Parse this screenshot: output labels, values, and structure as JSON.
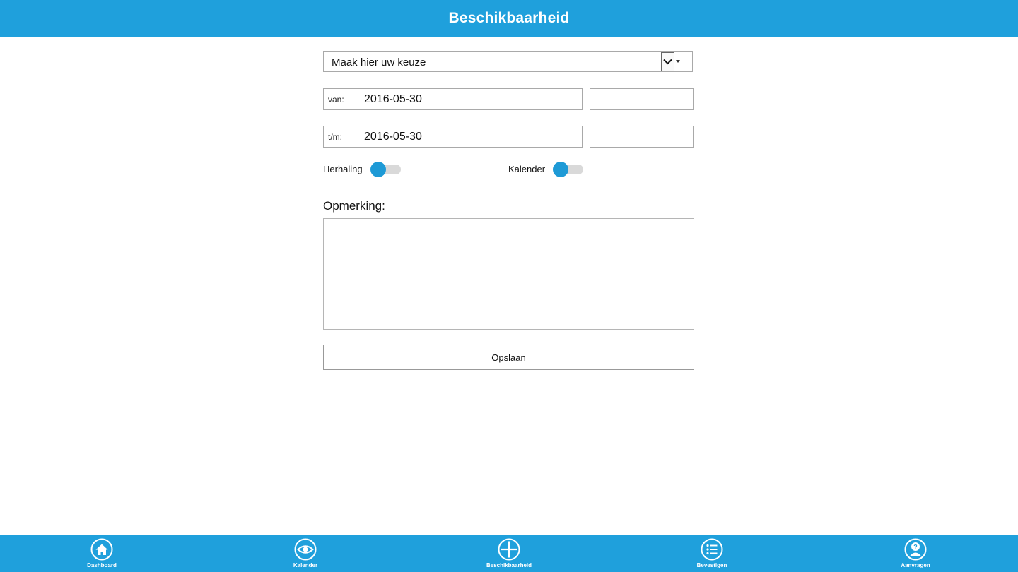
{
  "header": {
    "title": "Beschikbaarheid"
  },
  "form": {
    "select": {
      "value": "Maak hier uw keuze"
    },
    "from": {
      "label": "van:",
      "date": "2016-05-30",
      "time": ""
    },
    "to": {
      "label": "t/m:",
      "date": "2016-05-30",
      "time": ""
    },
    "toggles": [
      {
        "label": "Herhaling",
        "on": false
      },
      {
        "label": "Kalender",
        "on": false
      }
    ],
    "remark": {
      "label": "Opmerking:",
      "value": ""
    },
    "save_label": "Opslaan"
  },
  "nav": {
    "items": [
      {
        "label": "Dashboard",
        "icon": "home-icon"
      },
      {
        "label": "Kalender",
        "icon": "eye-icon"
      },
      {
        "label": "Beschikbaarheid",
        "icon": "plus-icon"
      },
      {
        "label": "Bevestigen",
        "icon": "list-icon"
      },
      {
        "label": "Aanvragen",
        "icon": "question-person-icon"
      }
    ]
  },
  "colors": {
    "accent": "#1fa0dc",
    "toggle_knob": "#1e9ad6",
    "toggle_track": "#d9d9d9"
  }
}
